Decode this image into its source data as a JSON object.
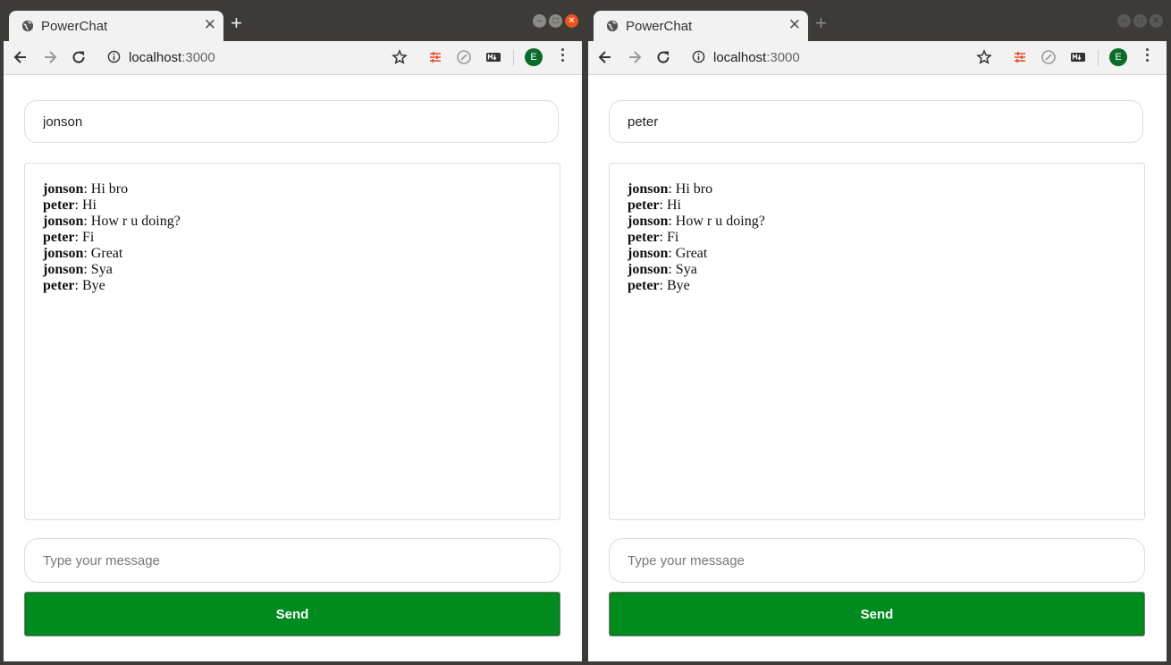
{
  "windows": [
    {
      "tab_title": "PowerChat",
      "url_host": "localhost",
      "url_port": ":3000",
      "avatar_letter": "E",
      "username": "jonson",
      "message_placeholder": "Type your message",
      "send_label": "Send",
      "messages": [
        {
          "user": "jonson",
          "text": ": Hi bro"
        },
        {
          "user": "peter",
          "text": ": Hi"
        },
        {
          "user": "jonson",
          "text": ": How r u doing?"
        },
        {
          "user": "peter",
          "text": ": Fi"
        },
        {
          "user": "jonson",
          "text": ": Great"
        },
        {
          "user": "jonson",
          "text": ": Sya"
        },
        {
          "user": "peter",
          "text": ": Bye"
        }
      ]
    },
    {
      "tab_title": "PowerChat",
      "url_host": "localhost",
      "url_port": ":3000",
      "avatar_letter": "E",
      "username": "peter",
      "message_placeholder": "Type your message",
      "send_label": "Send",
      "messages": [
        {
          "user": "jonson",
          "text": ": Hi bro"
        },
        {
          "user": "peter",
          "text": ": Hi"
        },
        {
          "user": "jonson",
          "text": ": How r u doing?"
        },
        {
          "user": "peter",
          "text": ": Fi"
        },
        {
          "user": "jonson",
          "text": ": Great"
        },
        {
          "user": "jonson",
          "text": ": Sya"
        },
        {
          "user": "peter",
          "text": ": Bye"
        }
      ]
    }
  ],
  "colors": {
    "send_button": "#008b1e",
    "titlebar": "#3c3b37",
    "close_button_active": "#e95420",
    "avatar": "#0b6b2a"
  },
  "icons": [
    "globe-icon",
    "close-icon",
    "new-tab-icon",
    "back-icon",
    "forward-icon",
    "reload-icon",
    "info-icon",
    "star-icon",
    "extension-icon",
    "menu-icon"
  ]
}
